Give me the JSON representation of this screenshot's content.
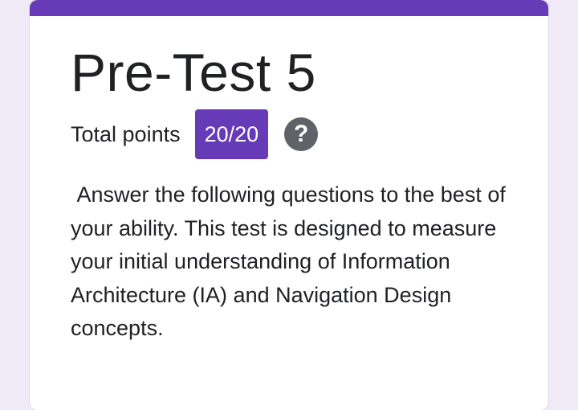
{
  "form": {
    "title": "Pre-Test 5",
    "total_points_label": "Total points",
    "score": "20/20",
    "help_icon": "question-mark-icon",
    "help_glyph": "?",
    "description": " Answer the following questions to the best of your ability. This test is designed to measure your initial understanding of Information Architecture (IA) and Navigation Design concepts."
  },
  "colors": {
    "accent": "#673ab7",
    "background": "#efeaf6",
    "text": "#202124",
    "help_icon": "#5f6368"
  }
}
